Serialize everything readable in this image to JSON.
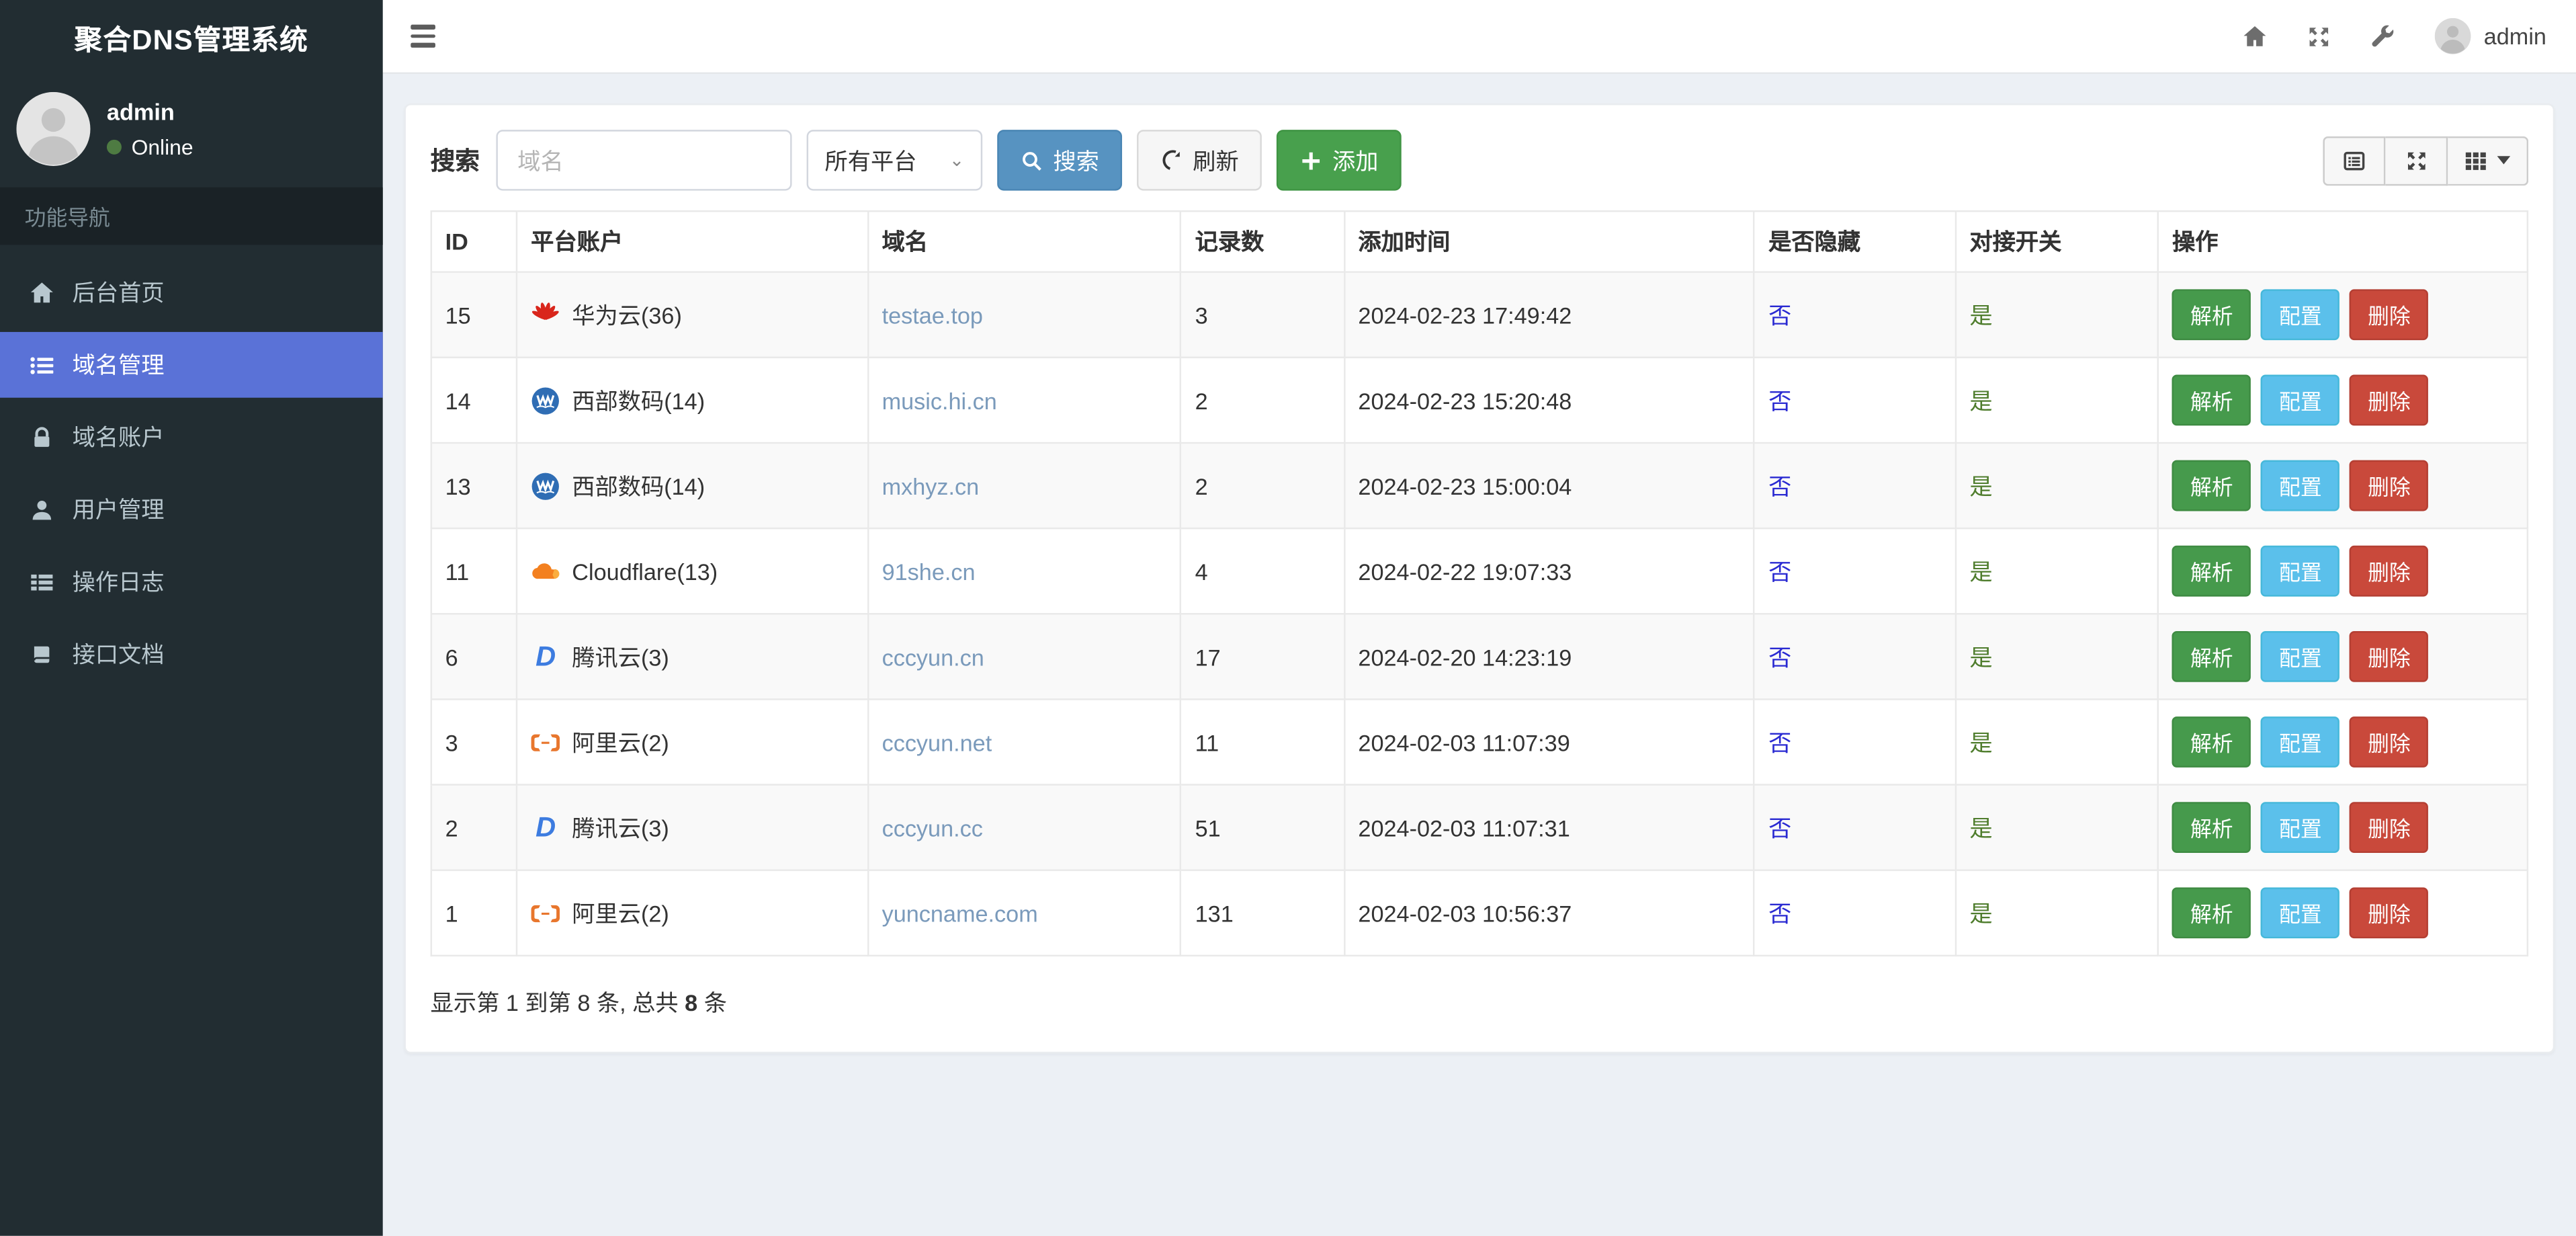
{
  "app": {
    "title": "聚合DNS管理系统"
  },
  "topbar": {
    "username": "admin"
  },
  "sidebar": {
    "user": {
      "name": "admin",
      "status": "Online"
    },
    "nav_header": "功能导航",
    "items": [
      {
        "key": "home",
        "label": "后台首页",
        "icon": "home-icon",
        "active": false
      },
      {
        "key": "domains",
        "label": "域名管理",
        "icon": "list-icon",
        "active": true
      },
      {
        "key": "accounts",
        "label": "域名账户",
        "icon": "lock-icon",
        "active": false
      },
      {
        "key": "users",
        "label": "用户管理",
        "icon": "user-icon",
        "active": false
      },
      {
        "key": "logs",
        "label": "操作日志",
        "icon": "th-list-icon",
        "active": false
      },
      {
        "key": "docs",
        "label": "接口文档",
        "icon": "book-icon",
        "active": false
      }
    ]
  },
  "toolbar": {
    "search_label": "搜索",
    "search_placeholder": "域名",
    "platform_select_value": "所有平台",
    "search_button": "搜索",
    "refresh_button": "刷新",
    "add_button": "添加"
  },
  "table": {
    "columns": [
      "ID",
      "平台账户",
      "域名",
      "记录数",
      "添加时间",
      "是否隐藏",
      "对接开关",
      "操作"
    ],
    "action_labels": {
      "resolve": "解析",
      "config": "配置",
      "delete": "删除"
    },
    "rows": [
      {
        "id": "15",
        "platform": "华为云(36)",
        "platform_icon": "huawei-icon",
        "domain": "testae.top",
        "records": "3",
        "added": "2024-02-23 17:49:42",
        "hidden": "否",
        "switch": "是"
      },
      {
        "id": "14",
        "platform": "西部数码(14)",
        "platform_icon": "west-digital-icon",
        "domain": "music.hi.cn",
        "records": "2",
        "added": "2024-02-23 15:20:48",
        "hidden": "否",
        "switch": "是"
      },
      {
        "id": "13",
        "platform": "西部数码(14)",
        "platform_icon": "west-digital-icon",
        "domain": "mxhyz.cn",
        "records": "2",
        "added": "2024-02-23 15:00:04",
        "hidden": "否",
        "switch": "是"
      },
      {
        "id": "11",
        "platform": "Cloudflare(13)",
        "platform_icon": "cloudflare-icon",
        "domain": "91she.cn",
        "records": "4",
        "added": "2024-02-22 19:07:33",
        "hidden": "否",
        "switch": "是"
      },
      {
        "id": "6",
        "platform": "腾讯云(3)",
        "platform_icon": "dnspod-icon",
        "domain": "cccyun.cn",
        "records": "17",
        "added": "2024-02-20 14:23:19",
        "hidden": "否",
        "switch": "是"
      },
      {
        "id": "3",
        "platform": "阿里云(2)",
        "platform_icon": "aliyun-icon",
        "domain": "cccyun.net",
        "records": "11",
        "added": "2024-02-03 11:07:39",
        "hidden": "否",
        "switch": "是"
      },
      {
        "id": "2",
        "platform": "腾讯云(3)",
        "platform_icon": "dnspod-icon",
        "domain": "cccyun.cc",
        "records": "51",
        "added": "2024-02-03 11:07:31",
        "hidden": "否",
        "switch": "是"
      },
      {
        "id": "1",
        "platform": "阿里云(2)",
        "platform_icon": "aliyun-icon",
        "domain": "yuncname.com",
        "records": "131",
        "added": "2024-02-03 10:56:37",
        "hidden": "否",
        "switch": "是"
      }
    ]
  },
  "pagination": {
    "prefix": "显示第 1 到第 8 条, 总共 ",
    "total": "8",
    "suffix": " 条"
  },
  "colors": {
    "active_nav": "#5a72d7",
    "primary_btn": "#5793c1",
    "success_btn": "#48a04d",
    "resolve_btn": "#469a4c",
    "config_btn": "#5bc0eb",
    "delete_btn": "#c9493b",
    "hidden_no": "#2a2ad2",
    "switch_yes": "#4f7d2d",
    "domain_link": "#7a9abb"
  }
}
